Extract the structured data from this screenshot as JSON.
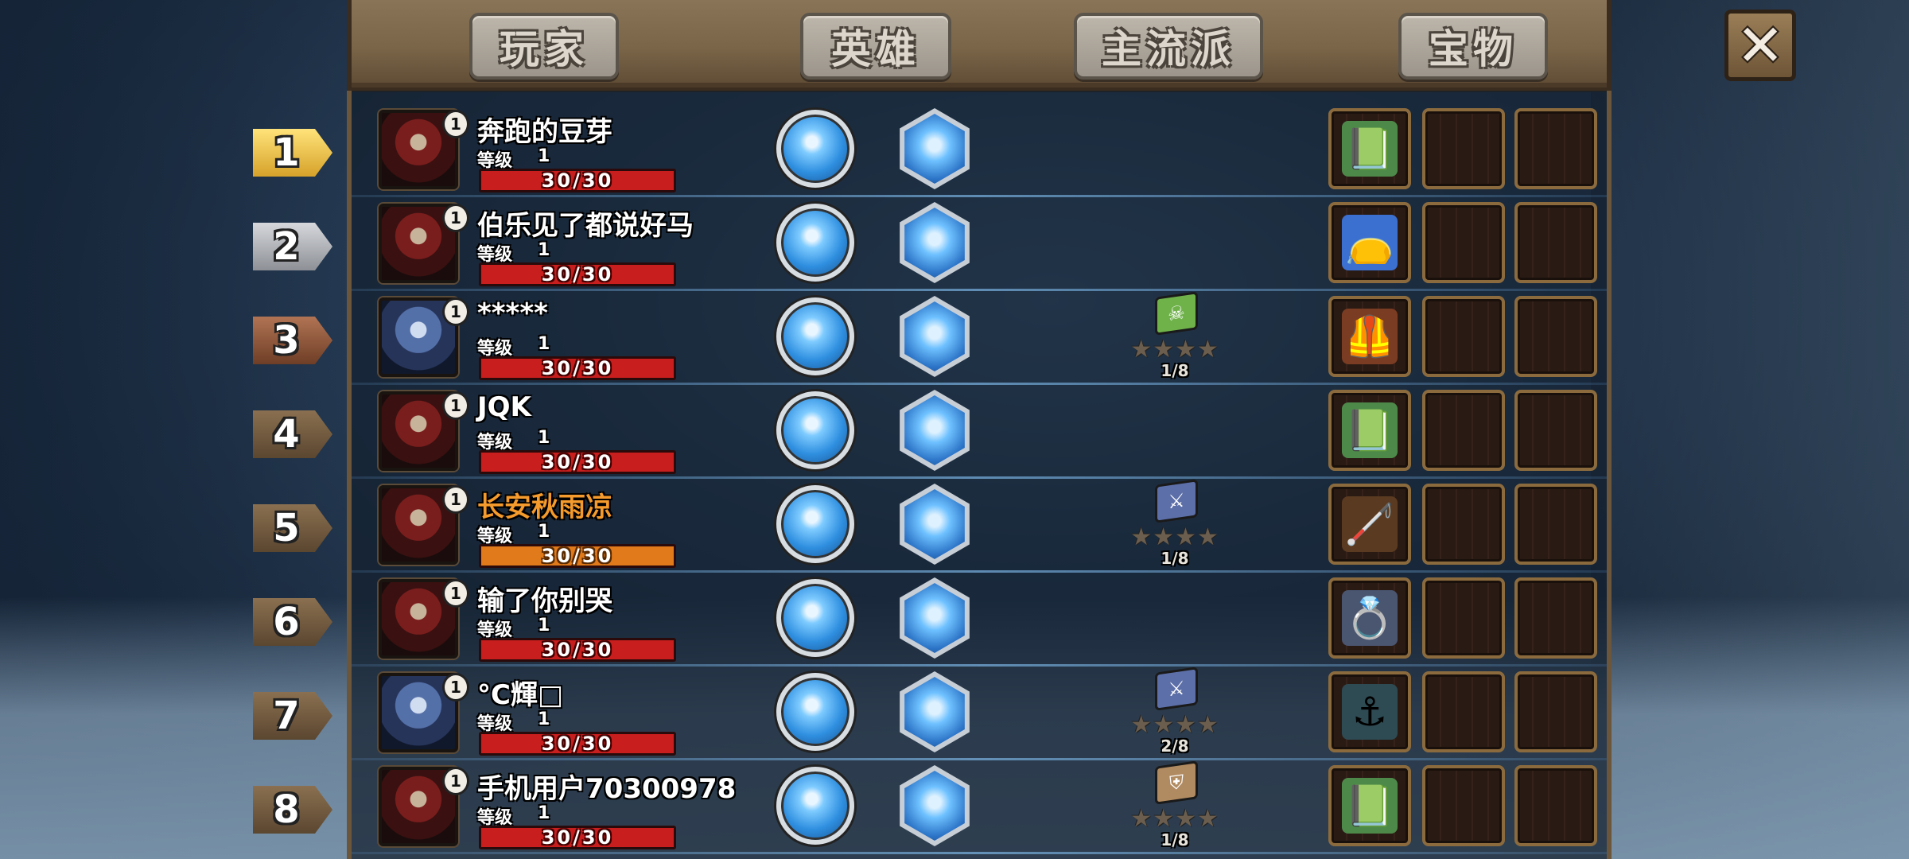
{
  "tabs": [
    "玩家",
    "英雄",
    "主流派",
    "宝物"
  ],
  "close_label": "✕",
  "level_label": "等级",
  "players": [
    {
      "rank": "1",
      "name": "奔跑的豆芽",
      "level": "1",
      "hp": "30/30",
      "hero": "red",
      "name_color": "white",
      "genre": null,
      "treasure": "green-book"
    },
    {
      "rank": "2",
      "name": "伯乐见了都说好马",
      "level": "1",
      "hp": "30/30",
      "hero": "red",
      "name_color": "white",
      "genre": null,
      "treasure": "blue-pouch"
    },
    {
      "rank": "3",
      "name": "*****",
      "level": "1",
      "hp": "30/30",
      "hero": "blue",
      "name_color": "white",
      "genre": {
        "icon": "skull-book",
        "progress": "1/8"
      },
      "treasure": "leather-armor"
    },
    {
      "rank": "4",
      "name": "JQK",
      "level": "1",
      "hp": "30/30",
      "hero": "red",
      "name_color": "white",
      "genre": null,
      "treasure": "green-book"
    },
    {
      "rank": "5",
      "name": "长安秋雨凉",
      "level": "1",
      "hp": "30/30",
      "hero": "red",
      "name_color": "orange",
      "genre": {
        "icon": "sword-book",
        "progress": "1/8"
      },
      "treasure": "staff"
    },
    {
      "rank": "6",
      "name": "输了你别哭",
      "level": "1",
      "hp": "30/30",
      "hero": "red",
      "name_color": "white",
      "genre": null,
      "treasure": "gem-ring"
    },
    {
      "rank": "7",
      "name": "°C輝□",
      "level": "1",
      "hp": "30/30",
      "hero": "blue",
      "name_color": "white",
      "genre": {
        "icon": "sword-book",
        "progress": "2/8"
      },
      "treasure": "anchor"
    },
    {
      "rank": "8",
      "name": "手机用户70300978",
      "level": "1",
      "hp": "30/30",
      "hero": "red",
      "name_color": "white",
      "genre": {
        "icon": "shield-book",
        "progress": "1/8"
      },
      "treasure": "green-book"
    }
  ],
  "genre_stars": "★★★★",
  "colors": {
    "hp_red": "#c81e1e",
    "hp_orange": "#e07a1a",
    "name_orange": "#f59a2c",
    "wood": "#7a6548"
  }
}
